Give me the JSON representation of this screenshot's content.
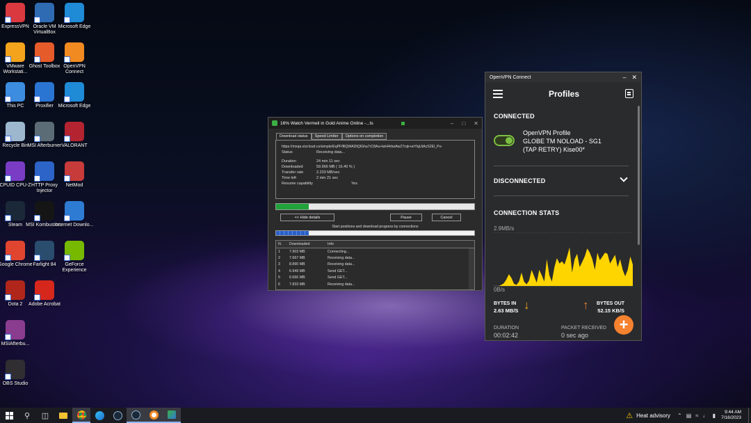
{
  "desktop": {
    "icons": [
      {
        "label": "ExpressVPN",
        "icon": "expressvpn-icon",
        "color": "#da3940"
      },
      {
        "label": "Oracle VM VirtualBox",
        "icon": "virtualbox-icon",
        "color": "#2f6bb3"
      },
      {
        "label": "Microsoft Edge",
        "icon": "edge-icon",
        "color": "#1f8ad6"
      },
      {
        "label": "VMware Workstati...",
        "icon": "vmware-icon",
        "color": "#f3a41c"
      },
      {
        "label": "Ghost Toolbox",
        "icon": "ghost-toolbox-icon",
        "color": "#e65b2a"
      },
      {
        "label": "OpenVPN Connect",
        "icon": "openvpn-icon",
        "color": "#f18a21"
      },
      {
        "label": "This PC",
        "icon": "this-pc-icon",
        "color": "#3c8de0"
      },
      {
        "label": "Proxifier",
        "icon": "proxifier-icon",
        "color": "#2b75d2"
      },
      {
        "label": "Microsoft Edge",
        "icon": "edge-icon",
        "color": "#1f8ad6"
      },
      {
        "label": "Recycle Bin",
        "icon": "recycle-bin-icon",
        "color": "#9db7cf"
      },
      {
        "label": "MSI Afterburner",
        "icon": "msi-afterburner-icon",
        "color": "#5c6c77"
      },
      {
        "label": "VALORANT",
        "icon": "valorant-icon",
        "color": "#b32430"
      },
      {
        "label": "CPUID CPU-Z",
        "icon": "cpuz-icon",
        "color": "#7a3cc4"
      },
      {
        "label": "HTTP Proxy Injector",
        "icon": "http-proxy-injector-icon",
        "color": "#2c64c8"
      },
      {
        "label": "NetMod",
        "icon": "netmod-icon",
        "color": "#c83b3b"
      },
      {
        "label": "Steam",
        "icon": "steam-icon",
        "color": "#1b2838"
      },
      {
        "label": "MSI Kombustor...",
        "icon": "msi-kombustor-icon",
        "color": "#151515"
      },
      {
        "label": "Internet Downlo...",
        "icon": "idm-icon",
        "color": "#2e7bd4"
      },
      {
        "label": "Google Chrome",
        "icon": "chrome-icon",
        "color": "#e0452f"
      },
      {
        "label": "Farlight 84",
        "icon": "farlight-icon",
        "color": "#2a4d6e"
      },
      {
        "label": "GeForce Experience",
        "icon": "geforce-icon",
        "color": "#76b900"
      },
      {
        "label": "Dota 2",
        "icon": "dota2-icon",
        "color": "#b0261b"
      },
      {
        "label": "Adobe Acrobat",
        "icon": "acrobat-icon",
        "color": "#d6271d"
      },
      {
        "label": "MSIAfterbu...",
        "icon": "winrar-icon",
        "color": "#8a3c8f"
      },
      {
        "label": "OBS Studio",
        "icon": "obs-icon",
        "color": "#302e31"
      }
    ]
  },
  "idm": {
    "title": "16% Watch Vermeil in Gold Anime Online -...ts",
    "tabs": [
      "Download status",
      "Speed Limiter",
      "Options on completion"
    ],
    "url": "https://mxqa.vizcloud.co/simple/EqPFIfllQWADtQlGha7rC8Au+lwH4rbsAwZ7rqk+wYIqUtAcS2El_Po-",
    "status_label": "Status",
    "status_value": "Receiving data...",
    "rows": [
      {
        "k": "Duration",
        "v": "24 min 11 sec"
      },
      {
        "k": "Downloaded",
        "v": "59.966  MB  ( 16.40 % )"
      },
      {
        "k": "Transfer rate",
        "v": "2.233  MB/sec"
      },
      {
        "k": "Time left",
        "v": "2 min 21 sec"
      },
      {
        "k": "Resume capability",
        "v": "Yes"
      }
    ],
    "progress": 0.164,
    "hide_details": "<< Hide details",
    "pause": "Pause",
    "cancel": "Cancel",
    "caption": "Start positions and download progress by connections",
    "table_headers": [
      "N.",
      "Downloaded",
      "Info"
    ],
    "connections": [
      {
        "n": "1",
        "dl": "7.903  MB",
        "info": "Connecting..."
      },
      {
        "n": "2",
        "dl": "7.667  MB",
        "info": "Receiving data..."
      },
      {
        "n": "3",
        "dl": "8.890  MB",
        "info": "Receiving data..."
      },
      {
        "n": "4",
        "dl": "6.949  MB",
        "info": "Send GET..."
      },
      {
        "n": "5",
        "dl": "6.666  MB",
        "info": "Send GET..."
      },
      {
        "n": "6",
        "dl": "7.833  MB",
        "info": "Receiving data..."
      }
    ]
  },
  "openvpn": {
    "window_title": "OpenVPN Connect",
    "header_title": "Profiles",
    "connected_label": "CONNECTED",
    "profile_name": "OpenVPN Profile",
    "profile_line1": "GLOBE TM NOLOAD - SG1",
    "profile_line2": "(TAP RETRY) Kise00*",
    "disconnected_label": "DISCONNECTED",
    "stats_label": "CONNECTION STATS",
    "max_label": "2.9MB/s",
    "min_label": "0B/s",
    "bytes_in_label": "BYTES IN",
    "bytes_in_value": "2.63 MB/S",
    "bytes_out_label": "BYTES OUT",
    "bytes_out_value": "52.15 KB/S",
    "duration_label": "DURATION",
    "duration_value": "00:02:42",
    "packet_label": "PACKET RECEIVED",
    "packet_value": "0 sec ago",
    "accent": "#f5a623",
    "graph_color": "#ffd500",
    "graph_values": [
      0.0,
      0.0,
      0.0,
      0.02,
      0.05,
      0.12,
      0.22,
      0.15,
      0.04,
      0.02,
      0.08,
      0.25,
      0.08,
      0.03,
      0.1,
      0.3,
      0.18,
      0.06,
      0.3,
      0.2,
      0.08,
      0.5,
      0.2,
      0.08,
      0.35,
      0.52,
      0.42,
      0.46,
      0.4,
      0.55,
      0.72,
      0.25,
      0.5,
      0.6,
      0.35,
      0.45,
      0.55,
      0.7,
      0.62,
      0.5,
      0.3,
      0.62,
      0.48,
      0.55,
      0.62,
      0.6,
      0.42,
      0.5,
      0.58,
      0.35,
      0.5,
      0.3,
      0.18,
      0.3,
      0.55,
      0.4
    ]
  },
  "taskbar": {
    "weather": "Heat advisory",
    "time": "9:44 AM",
    "date": "7/16/2023"
  }
}
